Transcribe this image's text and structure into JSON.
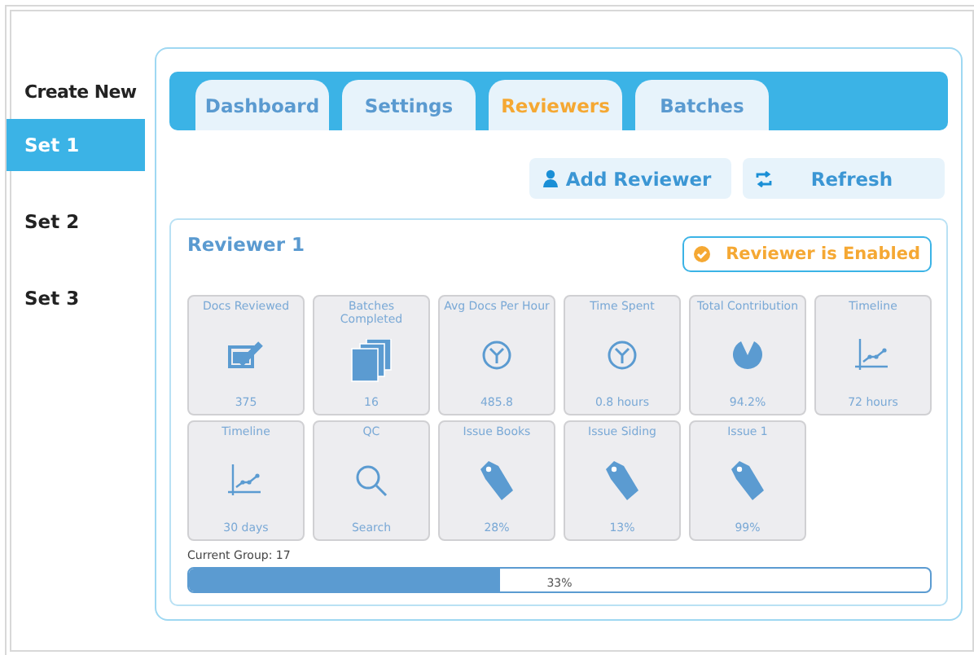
{
  "sidebar": {
    "items": [
      {
        "label": "Create New",
        "selected": false
      },
      {
        "label": "Set 1",
        "selected": true
      },
      {
        "label": "Set 2",
        "selected": false
      },
      {
        "label": "Set 3",
        "selected": false
      }
    ]
  },
  "tabs": [
    {
      "label": "Dashboard",
      "selected": false
    },
    {
      "label": "Settings",
      "selected": false
    },
    {
      "label": "Reviewers",
      "selected": true
    },
    {
      "label": "Batches",
      "selected": false
    }
  ],
  "actions": [
    {
      "label": "Add Reviewer",
      "kind": "person"
    },
    {
      "label": "Refresh",
      "kind": "refresh"
    }
  ],
  "reviewer": {
    "title": "Reviewer 1",
    "status": "Reviewer is Enabled",
    "enabled": true,
    "tiles": [
      {
        "title": "Docs Reviewed",
        "value": "375",
        "kind": "check"
      },
      {
        "title": "Batches Completed",
        "value": "16",
        "kind": "pages"
      },
      {
        "title": "Avg Docs Per Hour",
        "value": "485.8",
        "kind": "clock"
      },
      {
        "title": "Time Spent",
        "value": "0.8 hours",
        "kind": "clock"
      },
      {
        "title": "Total Contribution",
        "value": "94.2%",
        "kind": "pie"
      },
      {
        "title": "Timeline",
        "value": "72 hours",
        "kind": "chart"
      },
      {
        "title": "Timeline",
        "value": "30 days",
        "kind": "chart"
      },
      {
        "title": "QC",
        "value": "Search",
        "kind": "search"
      },
      {
        "title": "Issue Books",
        "value": "28%",
        "kind": "tag"
      },
      {
        "title": "Issue Siding",
        "value": "13%",
        "kind": "tag"
      },
      {
        "title": "Issue 1",
        "value": "99%",
        "kind": "tag"
      }
    ],
    "group_label": "Current Group: 17",
    "progress": {
      "level": 0.42,
      "reading": "33%"
    }
  }
}
